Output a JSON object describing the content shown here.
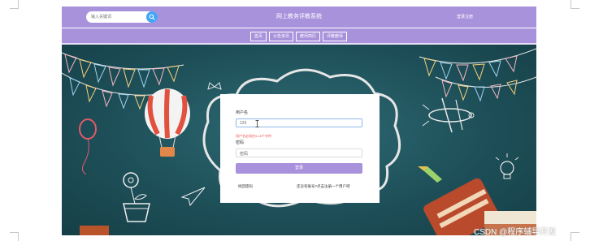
{
  "header": {
    "search_placeholder": "输入关键词",
    "site_title": "网上教务评教系统",
    "login_register": "登录注册"
  },
  "nav": {
    "items": [
      "首页",
      "公告资讯",
      "教师简历",
      "评教教师"
    ]
  },
  "login": {
    "username_label": "用户名",
    "username_value": "123",
    "username_error": "用户名必须在5-16个字符",
    "password_label": "密码",
    "password_placeholder": "密码",
    "submit_label": "登录",
    "forgot_link": "找回密码",
    "register_link": "还没有账号?点击注册一个用户吧"
  },
  "watermark": "CSDN @程序辅导开发",
  "colors": {
    "header_bg": "#a992dc",
    "scene_bg": "#1d4d57",
    "search_button": "#42a5f5",
    "error_text": "#e84b4b"
  },
  "icons": {
    "search": "search-icon",
    "text_cursor": "text-cursor-icon"
  }
}
